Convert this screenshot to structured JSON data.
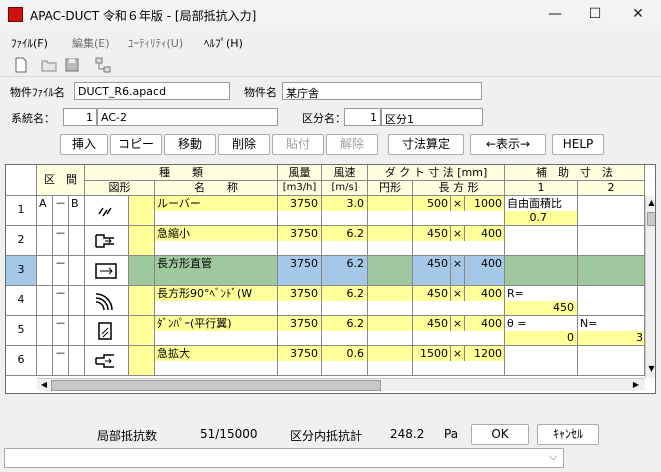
{
  "window": {
    "title": "APAC-DUCT 令和６年版 - [局部抵抗入力]",
    "min": "—",
    "max": "☐",
    "close": "✕"
  },
  "menu": [
    "ﾌｧｲﾙ(F)",
    "編集(E)",
    "ﾕｰﾃｨﾘﾃｨ(U)",
    "ﾍﾙﾌﾟ(H)"
  ],
  "toolbar_icons": [
    "new-file-icon",
    "open-folder-icon",
    "save-icon",
    "network-icon"
  ],
  "info": {
    "file_label": "物件ﾌｧｲﾙ名",
    "file_value": "DUCT_R6.apacd",
    "property_label": "物件名",
    "property_value": "某庁舎",
    "system_label": "系統名：",
    "system_no": "1",
    "system_value": "AC-2",
    "section_label": "区分名：",
    "section_no": "1",
    "section_value": "区分1"
  },
  "buttons": [
    "挿入",
    "コピー",
    "移動",
    "削除",
    "貼付",
    "解除",
    "寸法算定",
    "←表示→",
    "HELP"
  ],
  "header": {
    "kukan": "区　間",
    "zukei": "図形",
    "shurui": "種　　類",
    "meisho": "名　　称",
    "furyou": "風量",
    "furyou_unit": "[m3/h]",
    "fusoku": "風速",
    "fusoku_unit": "[m/s]",
    "duct": "ダ ク ト 寸 法 [mm]",
    "enkei": "円形",
    "houkei": "長 方 形",
    "hojo": "補　助　寸　法",
    "c1": "1",
    "c2": "2"
  },
  "rows": [
    {
      "no": "1",
      "a": "A",
      "dash": "－",
      "b": "B",
      "icon": "louver-icon",
      "name": "ルーバー",
      "flow": "3750",
      "vel": "3.0",
      "w": "500",
      "x": "×",
      "h": "1000",
      "aux1": "自由面積比",
      "aux1b": "0.7",
      "aux2": "",
      "aux2b": ""
    },
    {
      "no": "2",
      "a": "",
      "dash": "－",
      "b": "",
      "icon": "contraction-icon",
      "name": "急縮小",
      "flow": "3750",
      "vel": "6.2",
      "w": "450",
      "x": "×",
      "h": "400",
      "aux1": "",
      "aux1b": "",
      "aux2": "",
      "aux2b": ""
    },
    {
      "no": "3",
      "a": "",
      "dash": "－",
      "b": "",
      "icon": "straight-duct-icon",
      "name": "長方形直管",
      "flow": "3750",
      "vel": "6.2",
      "w": "450",
      "x": "×",
      "h": "400",
      "aux1": "",
      "aux1b": "",
      "aux2": "",
      "aux2b": ""
    },
    {
      "no": "4",
      "a": "",
      "dash": "－",
      "b": "",
      "icon": "bend-icon",
      "name": "長方形90°ﾍﾞﾝﾄﾞ(W",
      "flow": "3750",
      "vel": "6.2",
      "w": "450",
      "x": "×",
      "h": "400",
      "aux1": "R=",
      "aux1b": "450",
      "aux2": "",
      "aux2b": ""
    },
    {
      "no": "5",
      "a": "",
      "dash": "－",
      "b": "",
      "icon": "damper-icon",
      "name": "ﾀﾞﾝﾊﾟｰ(平行翼)",
      "flow": "3750",
      "vel": "6.2",
      "w": "450",
      "x": "×",
      "h": "400",
      "aux1": "θ =",
      "aux1b": "0",
      "aux2": "N=",
      "aux2b": "3"
    },
    {
      "no": "6",
      "a": "",
      "dash": "－",
      "b": "",
      "icon": "expansion-icon",
      "name": "急拡大",
      "flow": "3750",
      "vel": "0.6",
      "w": "1500",
      "x": "×",
      "h": "1200",
      "aux1": "",
      "aux1b": "",
      "aux2": "",
      "aux2b": ""
    }
  ],
  "footer": {
    "resist_label": "局部抵抗数",
    "resist_value": "51/15000",
    "section_resist_label": "区分内抵抗計",
    "section_resist_value": "248.2",
    "unit": "Pa",
    "ok": "OK",
    "cancel": "ｷｬﾝｾﾙ"
  }
}
